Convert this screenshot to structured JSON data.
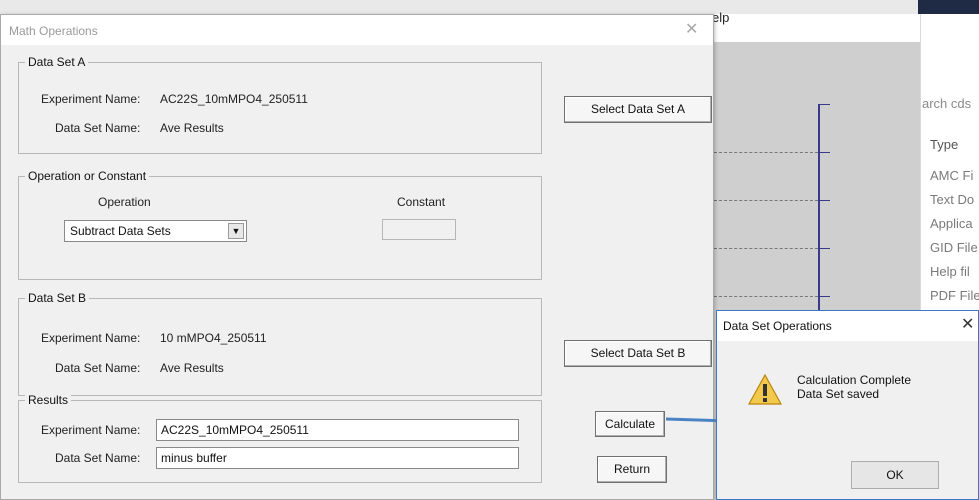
{
  "background": {
    "menu_fragment": "elp",
    "search_fragment": "arch cds",
    "type_header": "Type",
    "file_types": [
      "AMC Fi",
      "Text Do",
      "Applica",
      "GID File",
      "Help fil",
      "PDF File"
    ]
  },
  "math_window": {
    "title": "Math Operations",
    "data_set_a": {
      "group_title": "Data Set A",
      "experiment_label": "Experiment Name:",
      "experiment_value": "AC22S_10mMPO4_250511",
      "dataset_label": "Data Set Name:",
      "dataset_value": "Ave Results",
      "select_button": "Select Data Set A"
    },
    "operation": {
      "group_title": "Operation or Constant",
      "operation_label": "Operation",
      "operation_value": "Subtract Data Sets",
      "constant_label": "Constant",
      "constant_value": ""
    },
    "data_set_b": {
      "group_title": "Data Set B",
      "experiment_label": "Experiment Name:",
      "experiment_value": "10 mMPO4_250511",
      "dataset_label": "Data Set Name:",
      "dataset_value": "Ave Results",
      "select_button": "Select Data Set B"
    },
    "results": {
      "group_title": "Results",
      "experiment_label": "Experiment Name:",
      "experiment_value": "AC22S_10mMPO4_250511",
      "dataset_label": "Data Set Name:",
      "dataset_value": "minus buffer"
    },
    "calculate_button": "Calculate",
    "return_button": "Return"
  },
  "dialog": {
    "title": "Data Set Operations",
    "message_line1": "Calculation Complete",
    "message_line2": "Data Set saved",
    "ok_button": "OK"
  },
  "colors": {
    "dialog_border": "#3c78c8",
    "annotation_arrow": "#4a82c3",
    "graph_axis": "#3a3a8c"
  }
}
